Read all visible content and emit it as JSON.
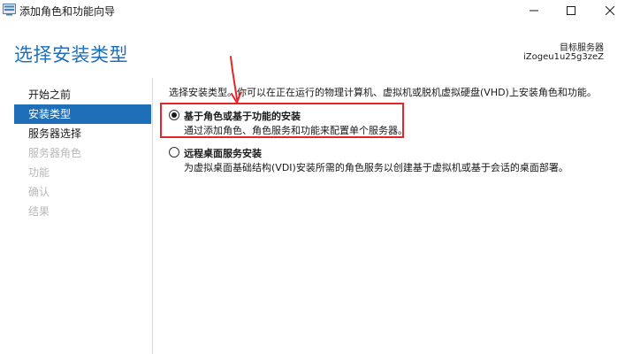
{
  "window": {
    "title": "添加角色和功能向导"
  },
  "header": {
    "page_title": "选择安装类型",
    "target_server_label": "目标服务器",
    "target_server_value": "iZogeu1u25g3zeZ"
  },
  "sidebar": {
    "items": [
      {
        "label": "开始之前",
        "state": "enabled"
      },
      {
        "label": "安装类型",
        "state": "active"
      },
      {
        "label": "服务器选择",
        "state": "enabled"
      },
      {
        "label": "服务器角色",
        "state": "disabled"
      },
      {
        "label": "功能",
        "state": "disabled"
      },
      {
        "label": "确认",
        "state": "disabled"
      },
      {
        "label": "结果",
        "state": "disabled"
      }
    ]
  },
  "main": {
    "intro": "选择安装类型。你可以在正在运行的物理计算机、虚拟机或脱机虚拟硬盘(VHD)上安装角色和功能。",
    "options": [
      {
        "title": "基于角色或基于功能的安装",
        "description": "通过添加角色、角色服务和功能来配置单个服务器。",
        "selected": true
      },
      {
        "title": "远程桌面服务安装",
        "description": "为虚拟桌面基础结构(VDI)安装所需的角色服务以创建基于虚拟机或基于会话的桌面部署。",
        "selected": false
      }
    ]
  },
  "colors": {
    "accent": "#1e6fb8",
    "annotation": "#e5252a",
    "disabled_text": "#b9b9b9"
  },
  "icons": {
    "app": "server-manager-icon",
    "minimize": "minimize-icon",
    "maximize": "maximize-icon",
    "close": "close-icon"
  }
}
